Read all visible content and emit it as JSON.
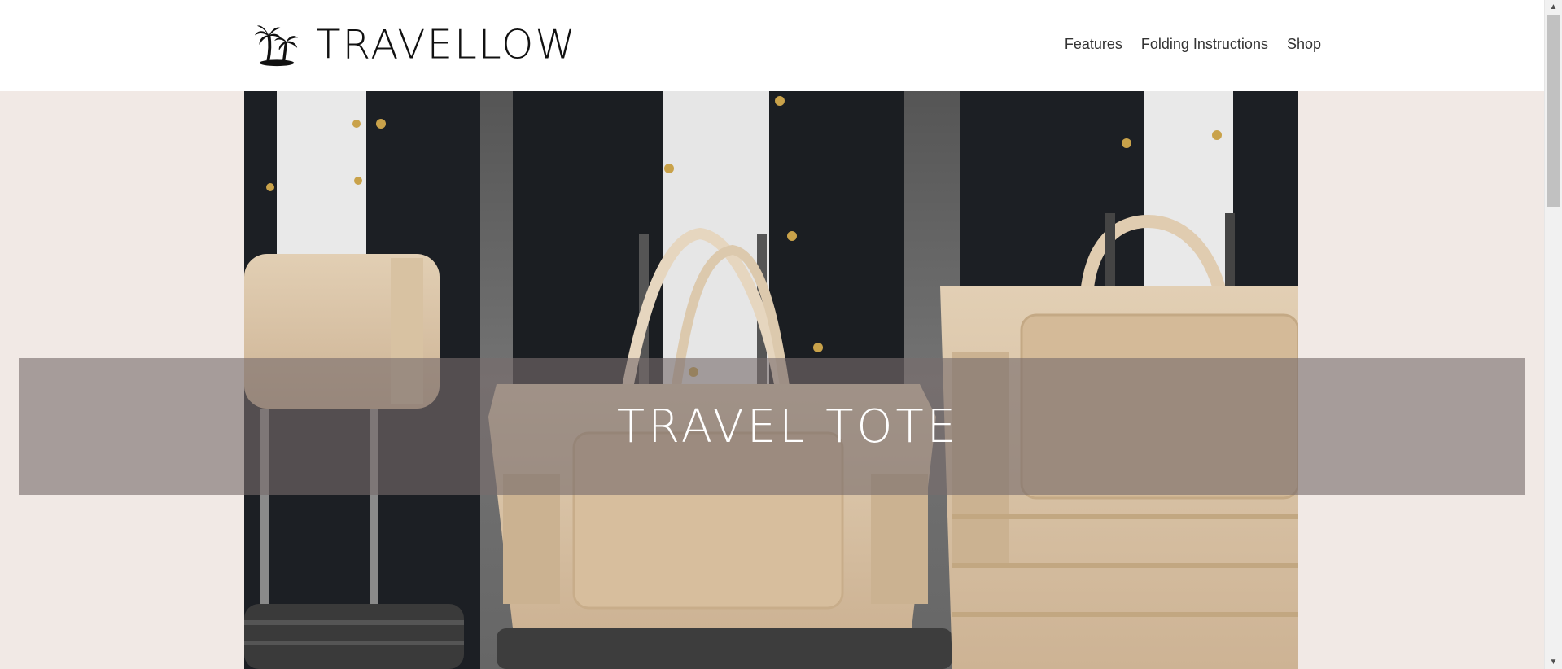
{
  "brand": {
    "name": "TRAVELLOW",
    "logo_icon": "palm-trees-icon"
  },
  "nav": {
    "items": [
      {
        "label": "Features"
      },
      {
        "label": "Folding Instructions"
      },
      {
        "label": "Shop"
      }
    ]
  },
  "hero": {
    "title": "TRAVEL TOTE",
    "image_alt": "three models holding travel tote bags on rolling luggage"
  },
  "colors": {
    "page_background": "#f1e9e5",
    "header_background": "#ffffff",
    "banner_overlay": "rgba(120,108,108,0.62)",
    "tote_beige": "#d9c2a3"
  },
  "scrollbar": {
    "up_icon": "scroll-up-arrow-icon",
    "down_icon": "scroll-down-arrow-icon"
  }
}
